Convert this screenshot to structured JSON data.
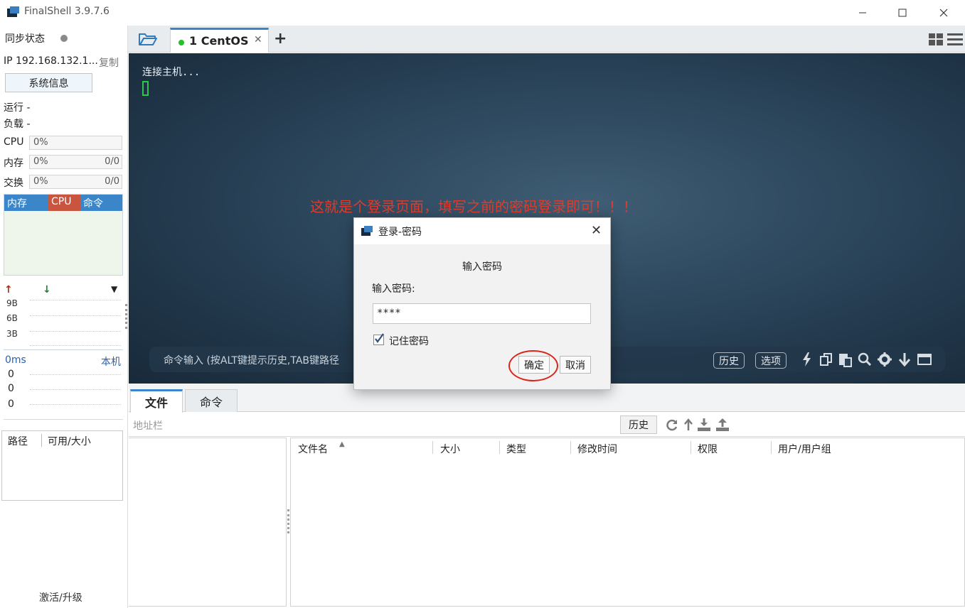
{
  "window": {
    "title": "FinalShell 3.9.7.6"
  },
  "sidebar": {
    "sync_label": "同步状态",
    "ip_label": "IP 192.168.132.1...",
    "copy_label": "复制",
    "sysinfo_button": "系统信息",
    "running_label": "运行 -",
    "load_label": "负载 -",
    "meters": [
      {
        "label": "CPU",
        "value": "0%",
        "extra": ""
      },
      {
        "label": "内存",
        "value": "0%",
        "extra": "0/0"
      },
      {
        "label": "交换",
        "value": "0%",
        "extra": "0/0"
      }
    ],
    "proc_columns": [
      "内存",
      "CPU",
      "命令"
    ],
    "net_axis": [
      "9B",
      "6B",
      "3B"
    ],
    "ping_label": "0ms",
    "local_label": "本机",
    "ping_values": [
      "0",
      "0",
      "0"
    ],
    "disk_columns": [
      "路径",
      "可用/大小"
    ],
    "activate_label": "激活/升级"
  },
  "tabs": {
    "session_tab": {
      "label": "1 CentOS",
      "status": "connected"
    }
  },
  "terminal": {
    "output": "连接主机...",
    "annotation": "这就是个登录页面，填写之前的密码登录即可！！！",
    "command_placeholder": "命令输入 (按ALT键提示历史,TAB键路径",
    "history_button": "历史",
    "options_button": "选项"
  },
  "lower_panel": {
    "tabs": [
      "文件",
      "命令"
    ],
    "address_placeholder": "地址栏",
    "history_button": "历史",
    "file_columns": [
      "文件名",
      "大小",
      "类型",
      "修改时间",
      "权限",
      "用户/用户组"
    ]
  },
  "dialog": {
    "title": "登录-密码",
    "heading": "输入密码",
    "field_label": "输入密码:",
    "password_value": "****",
    "remember_label": "记住密码",
    "remember_checked": true,
    "ok_button": "确定",
    "cancel_button": "取消"
  },
  "colors": {
    "accent": "#3a86c8",
    "annotation": "#e23b2a",
    "connected": "#22c02a",
    "cpu_header": "#c9553e"
  }
}
